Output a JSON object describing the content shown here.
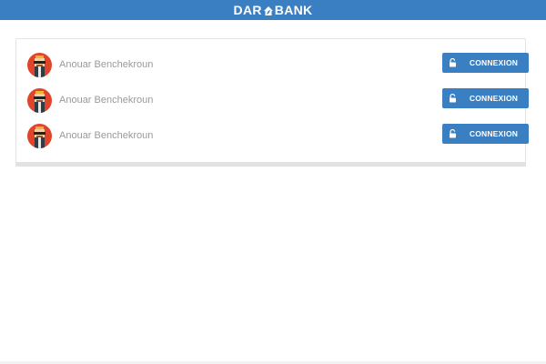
{
  "header": {
    "logo_left": "DAR",
    "logo_right": "BANK",
    "logo_icon": "house-leaf-icon",
    "brand_color": "#3a7fc1"
  },
  "accounts": [
    {
      "name": "Anouar Benchekroun",
      "avatar_icon": "avatar-icon",
      "button_label": "CONNEXION",
      "button_icon": "unlock-icon"
    },
    {
      "name": "Anouar Benchekroun",
      "avatar_icon": "avatar-icon",
      "button_label": "CONNEXION",
      "button_icon": "unlock-icon"
    },
    {
      "name": "Anouar Benchekroun",
      "avatar_icon": "avatar-icon",
      "button_label": "CONNEXION",
      "button_icon": "unlock-icon"
    }
  ]
}
